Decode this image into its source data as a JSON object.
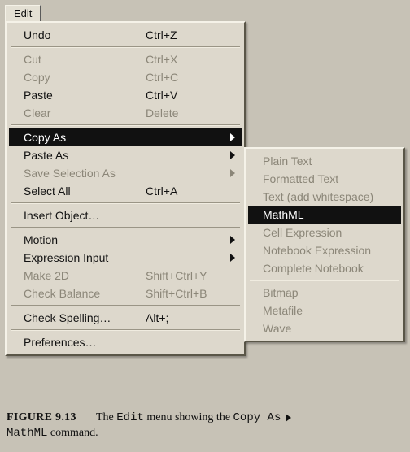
{
  "menuTitle": "Edit",
  "mainMenu": {
    "undo": {
      "label": "Undo",
      "shortcut": "Ctrl+Z"
    },
    "cut": {
      "label": "Cut",
      "shortcut": "Ctrl+X"
    },
    "copy": {
      "label": "Copy",
      "shortcut": "Ctrl+C"
    },
    "paste": {
      "label": "Paste",
      "shortcut": "Ctrl+V"
    },
    "clear": {
      "label": "Clear",
      "shortcut": "Delete"
    },
    "copyAs": {
      "label": "Copy As"
    },
    "pasteAs": {
      "label": "Paste As"
    },
    "saveSelAs": {
      "label": "Save Selection As"
    },
    "selectAll": {
      "label": "Select All",
      "shortcut": "Ctrl+A"
    },
    "insertObj": {
      "label": "Insert Object…"
    },
    "motion": {
      "label": "Motion"
    },
    "exprInput": {
      "label": "Expression Input"
    },
    "make2d": {
      "label": "Make 2D",
      "shortcut": "Shift+Ctrl+Y"
    },
    "checkBal": {
      "label": "Check Balance",
      "shortcut": "Shift+Ctrl+B"
    },
    "checkSpell": {
      "label": "Check Spelling…",
      "shortcut": "Alt+;"
    },
    "prefs": {
      "label": "Preferences…"
    }
  },
  "subMenu": {
    "plain": {
      "label": "Plain Text"
    },
    "fmt": {
      "label": "Formatted Text"
    },
    "ws": {
      "label": "Text (add whitespace)"
    },
    "mathml": {
      "label": "MathML"
    },
    "cellExpr": {
      "label": "Cell Expression"
    },
    "nbExpr": {
      "label": "Notebook Expression"
    },
    "compNb": {
      "label": "Complete Notebook"
    },
    "bitmap": {
      "label": "Bitmap"
    },
    "metafile": {
      "label": "Metafile"
    },
    "wave": {
      "label": "Wave"
    }
  },
  "caption": {
    "figLabel": "FIGURE 9.13",
    "pre": "The ",
    "mono1": "Edit",
    "mid": " menu showing the ",
    "mono2": "Copy As",
    "post1": " ",
    "mono3": "MathML",
    "post2": " command."
  }
}
